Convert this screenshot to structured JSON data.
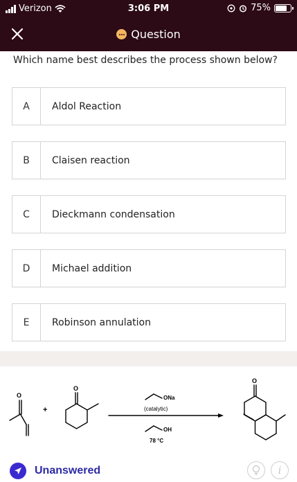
{
  "status_bar": {
    "carrier": "Verizon",
    "time": "3:06 PM",
    "battery": "75%"
  },
  "header": {
    "title": "Question"
  },
  "question": {
    "text": "Which name best describes the process shown below?"
  },
  "options": [
    {
      "letter": "A",
      "label": "Aldol Reaction"
    },
    {
      "letter": "B",
      "label": "Claisen reaction"
    },
    {
      "letter": "C",
      "label": "Dieckmann condensation"
    },
    {
      "letter": "D",
      "label": "Michael addition"
    },
    {
      "letter": "E",
      "label": "Robinson annulation"
    }
  ],
  "reaction": {
    "plus": "+",
    "base_label": "ONa",
    "catalytic": "(catalytic)",
    "solvent_label": "OH",
    "temperature": "78 °C",
    "o_label": "O"
  },
  "footer": {
    "status": "Unanswered"
  },
  "colors": {
    "header_bg": "#2c0a16",
    "accent": "#3a2ad1",
    "chat_icon": "#f3b65f"
  }
}
